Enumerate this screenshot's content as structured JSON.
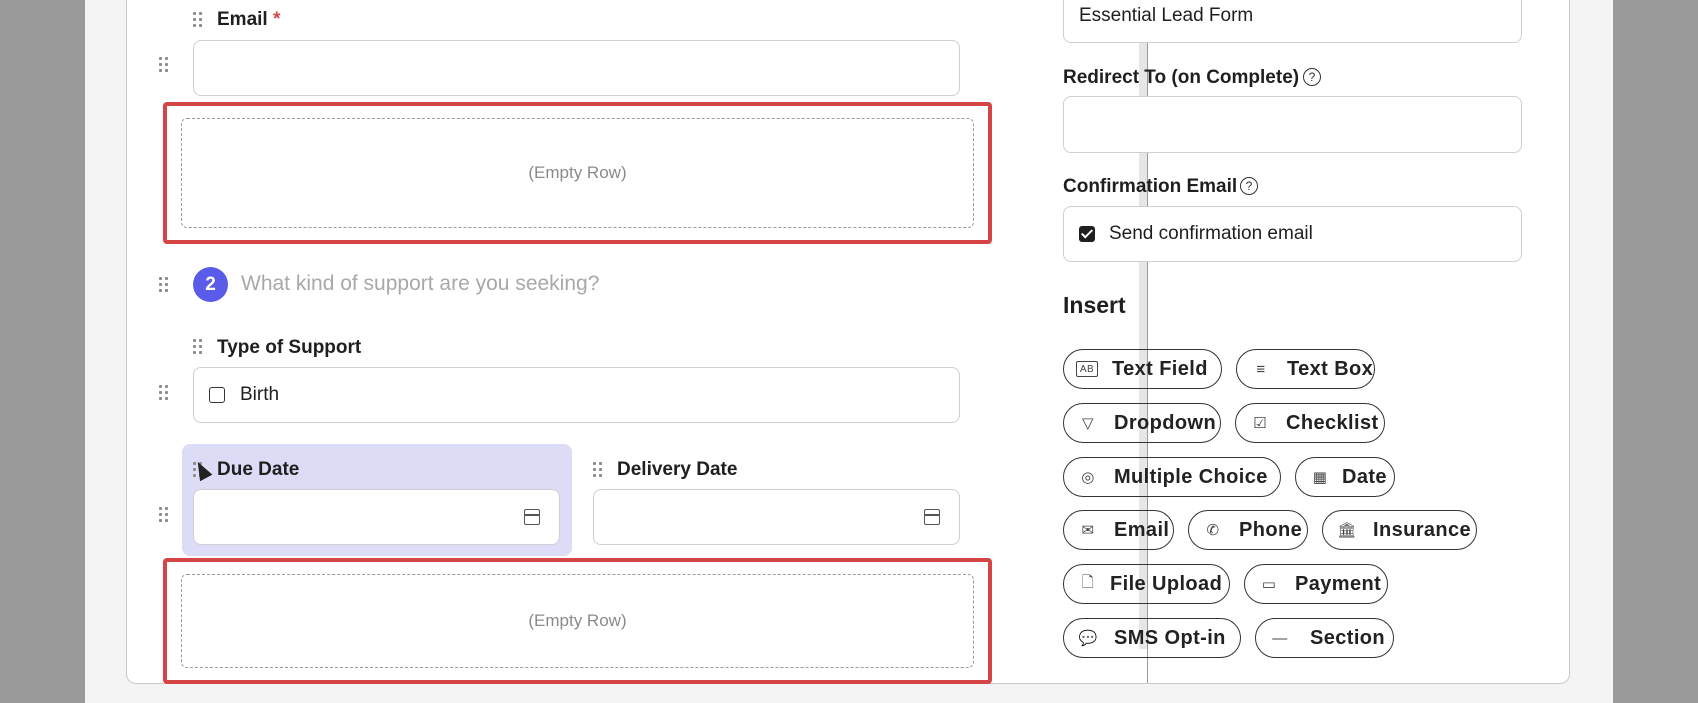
{
  "form": {
    "email_label": "Email",
    "email_required": "*",
    "empty_row_1": "(Empty Row)",
    "step_number": "2",
    "step_question": "What kind of support are you seeking?",
    "support_label": "Type of Support",
    "support_option": "Birth",
    "due_date_label": "Due Date",
    "delivery_date_label": "Delivery Date",
    "empty_row_2": "(Empty Row)"
  },
  "settings": {
    "form_name_value": "Essential Lead Form",
    "redirect_label": "Redirect To (on Complete)",
    "redirect_value": "",
    "confirmation_label": "Confirmation Email",
    "confirmation_checkbox": "Send confirmation email",
    "insert_title": "Insert",
    "help_glyph": "?"
  },
  "insert_items": [
    {
      "label": "Text Field",
      "icon": "text-field-icon",
      "glyph": "AB"
    },
    {
      "label": "Text Box",
      "icon": "text-box-icon",
      "glyph": "≡"
    },
    {
      "label": "Dropdown",
      "icon": "dropdown-icon",
      "glyph": "▽"
    },
    {
      "label": "Checklist",
      "icon": "checklist-icon",
      "glyph": "☑"
    },
    {
      "label": "Multiple Choice",
      "icon": "radio-icon",
      "glyph": "◎"
    },
    {
      "label": "Date",
      "icon": "calendar-icon",
      "glyph": "▦"
    },
    {
      "label": "Email",
      "icon": "envelope-icon",
      "glyph": "✉"
    },
    {
      "label": "Phone",
      "icon": "phone-icon",
      "glyph": "✆"
    },
    {
      "label": "Insurance",
      "icon": "bank-icon",
      "glyph": "🏛"
    },
    {
      "label": "File Upload",
      "icon": "file-icon",
      "glyph": "🗋"
    },
    {
      "label": "Payment",
      "icon": "card-icon",
      "glyph": "▭"
    },
    {
      "label": "SMS Opt-in",
      "icon": "sms-icon",
      "glyph": "💬"
    },
    {
      "label": "Section",
      "icon": "line-icon",
      "glyph": "—"
    }
  ]
}
